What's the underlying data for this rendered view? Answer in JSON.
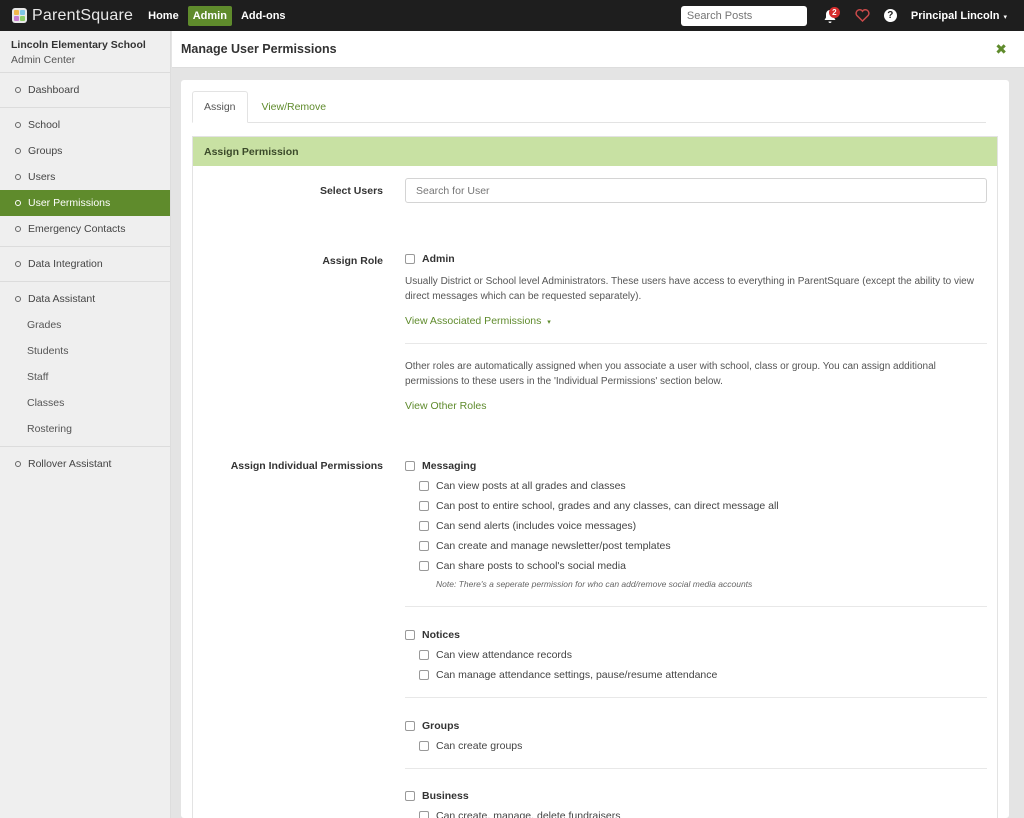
{
  "topbar": {
    "brand": "ParentSquare",
    "nav": [
      {
        "label": "Home",
        "active": false
      },
      {
        "label": "Admin",
        "active": true
      },
      {
        "label": "Add-ons",
        "active": false
      }
    ],
    "search_placeholder": "Search Posts",
    "notification_count": "2",
    "help_glyph": "?",
    "user_name": "Principal Lincoln",
    "user_caret": "▾",
    "colors": {
      "bar": "#1e1e1e",
      "accent": "#5f8b2c",
      "badge": "#d62e2e",
      "heart": "#c94a4a"
    }
  },
  "sidebar": {
    "school_name": "Lincoln Elementary School",
    "subtitle": "Admin Center",
    "items": [
      {
        "label": "Dashboard"
      },
      {
        "label": "School"
      },
      {
        "label": "Groups"
      },
      {
        "label": "Users"
      },
      {
        "label": "User Permissions",
        "active": true
      },
      {
        "label": "Emergency Contacts"
      },
      {
        "label": "Data Integration"
      },
      {
        "label": "Data Assistant"
      },
      {
        "label": "Rollover Assistant"
      }
    ],
    "data_assistant_sub": [
      "Grades",
      "Students",
      "Staff",
      "Classes",
      "Rostering"
    ]
  },
  "header": {
    "title": "Manage User Permissions",
    "close_glyph": "✖"
  },
  "tabs": [
    {
      "label": "Assign",
      "active": true
    },
    {
      "label": "View/Remove",
      "active": false
    }
  ],
  "assign": {
    "section_title": "Assign Permission",
    "select_users_label": "Select Users",
    "search_user_placeholder": "Search for User",
    "assign_role_label": "Assign Role",
    "role_admin": "Admin",
    "admin_desc": "Usually District or School level Administrators. These users have access to everything in ParentSquare (except the ability to view direct messages which can be requested separately).",
    "view_associated": "View Associated Permissions",
    "view_associated_caret": "▾",
    "other_roles_desc": "Other roles are automatically assigned when you associate a user with school, class or group. You can assign additional permissions to these users in the 'Individual Permissions' section below.",
    "view_other_roles": "View Other Roles",
    "individual_label": "Assign Individual Permissions",
    "groups": [
      {
        "name": "Messaging",
        "perms": [
          "Can view posts at all grades and classes",
          "Can post to entire school, grades and any classes, can direct message all",
          "Can send alerts (includes voice messages)",
          "Can create and manage newsletter/post templates",
          "Can share posts to school's social media"
        ],
        "note": "Note: There's a seperate permission for who can add/remove social media accounts"
      },
      {
        "name": "Notices",
        "perms": [
          "Can view attendance records",
          "Can manage attendance settings, pause/resume attendance"
        ]
      },
      {
        "name": "Groups",
        "perms": [
          "Can create groups"
        ]
      },
      {
        "name": "Business",
        "perms": [
          "Can create, manage, delete fundraisers"
        ]
      }
    ]
  }
}
